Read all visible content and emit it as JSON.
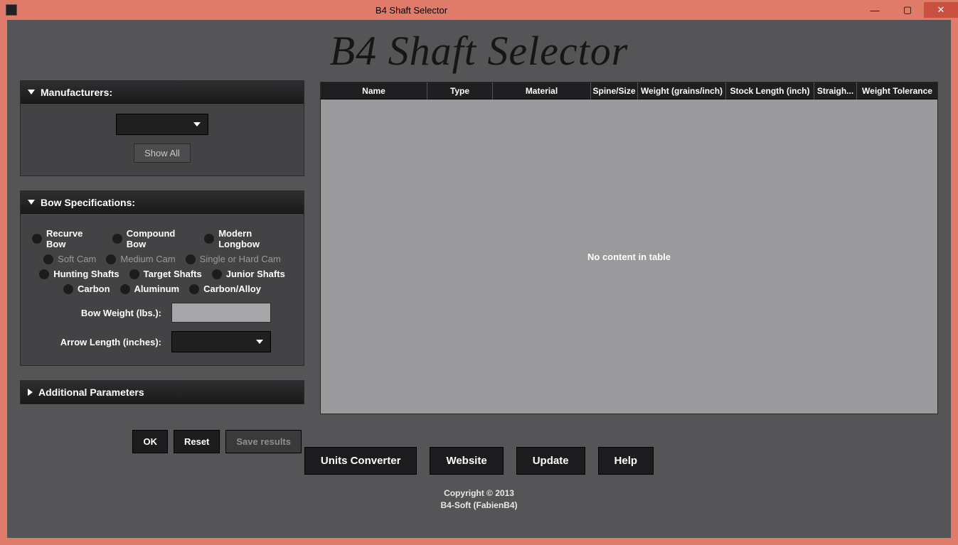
{
  "window": {
    "title": "B4 Shaft Selector"
  },
  "header": {
    "app_title": "B4 Shaft Selector"
  },
  "panels": {
    "manufacturers": {
      "title": "Manufacturers:",
      "selected": "",
      "show_all": "Show All"
    },
    "bow_spec": {
      "title": "Bow Specifications:",
      "bow_types": {
        "recurve": "Recurve Bow",
        "compound": "Compound Bow",
        "longbow": "Modern Longbow"
      },
      "cam_types": {
        "soft": "Soft Cam",
        "medium": "Medium Cam",
        "hard": "Single or Hard Cam"
      },
      "shaft_types": {
        "hunting": "Hunting Shafts",
        "target": "Target Shafts",
        "junior": "Junior Shafts"
      },
      "materials": {
        "carbon": "Carbon",
        "aluminum": "Aluminum",
        "carbon_alloy": "Carbon/Alloy"
      },
      "bow_weight_label": "Bow Weight (lbs.):",
      "bow_weight_value": "",
      "arrow_length_label": "Arrow Length (inches):",
      "arrow_length_selected": ""
    },
    "additional": {
      "title": "Additional Parameters"
    }
  },
  "actions": {
    "ok": "OK",
    "reset": "Reset",
    "save": "Save results"
  },
  "table": {
    "columns": {
      "name": "Name",
      "type": "Type",
      "material": "Material",
      "spine": "Spine/Size",
      "weight": "Weight (grains/inch)",
      "stock": "Stock Length (inch)",
      "straight": "Straigh...",
      "tolerance": "Weight Tolerance"
    },
    "empty_text": "No content in table"
  },
  "bottom_buttons": {
    "units": "Units Converter",
    "website": "Website",
    "update": "Update",
    "help": "Help"
  },
  "footer": {
    "line1": "Copyright © 2013",
    "line2": "B4-Soft (FabienB4)"
  }
}
